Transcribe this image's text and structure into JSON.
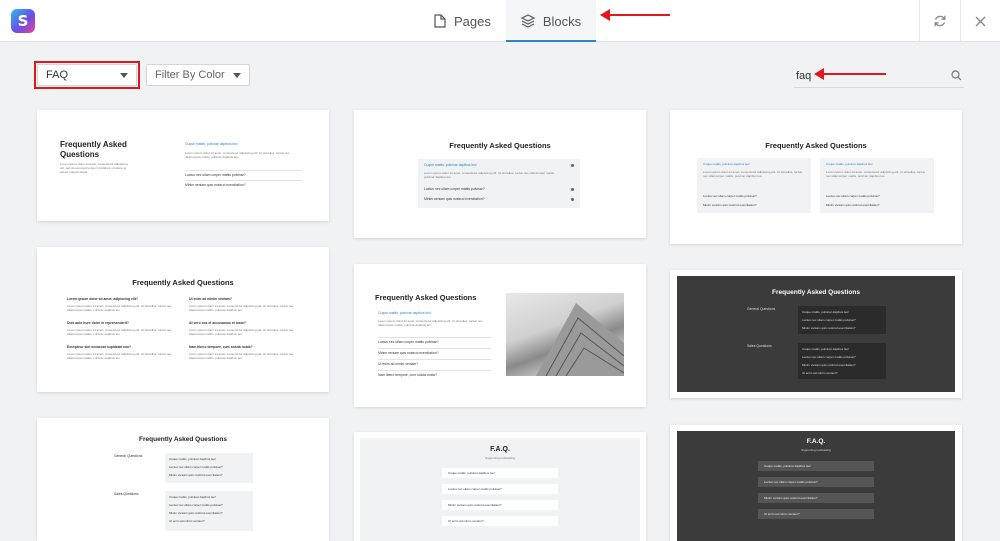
{
  "header": {
    "tabs": [
      {
        "label": "Pages",
        "icon": "page-icon"
      },
      {
        "label": "Blocks",
        "icon": "layers-icon",
        "active": true
      }
    ],
    "actions": [
      "refresh-icon",
      "close-icon"
    ]
  },
  "filters": {
    "category": "FAQ",
    "color_placeholder": "Filter By Color"
  },
  "search": {
    "value": "faq"
  },
  "accent_color": "#2d86c4",
  "annotation_color": "#e0181e",
  "blocks": {
    "faq_title": "Frequently Asked Questions",
    "faq_title_wrap": [
      "Frequently Asked",
      "Questions"
    ],
    "faq_short": "F.A.Q.",
    "supporting": "Supporting tooltsading",
    "q1": "Ut enim ad minim veniam?",
    "q_active": "Cuque mattis, pulvinar dapibus leo!",
    "q2": "Luctus nec ullam corper mattis pulvinar?",
    "q3": "Minim veniam quis nostrud exercitation?",
    "q4": "Ut enim ad minim veniam?",
    "q5": "Nam libero tempore, cum soluta nobis?",
    "q6": "Lorem ipsum dolor sit amet, adipiscing elit?",
    "q7": "Duis aute irure dolor in reprehenderit?",
    "q8": "At vero eos et accusamus et iusto?",
    "q9": "Excepteur sint occaecat cupidatat non?",
    "general": "General Questions",
    "sales": "Sales Questions",
    "body": "Lorem ipsum dolor sit amet, consectetur adipiscing elit. Ut elit tellus, luctus nec ullamcorper mattis, pulvinar dapibus leo.",
    "side_text": "Lorem ipsum dolor sit amet, consectetur adipiscing elit, sed do eiusmod tempor incididunt ut labore et dolore magna aliqua."
  }
}
